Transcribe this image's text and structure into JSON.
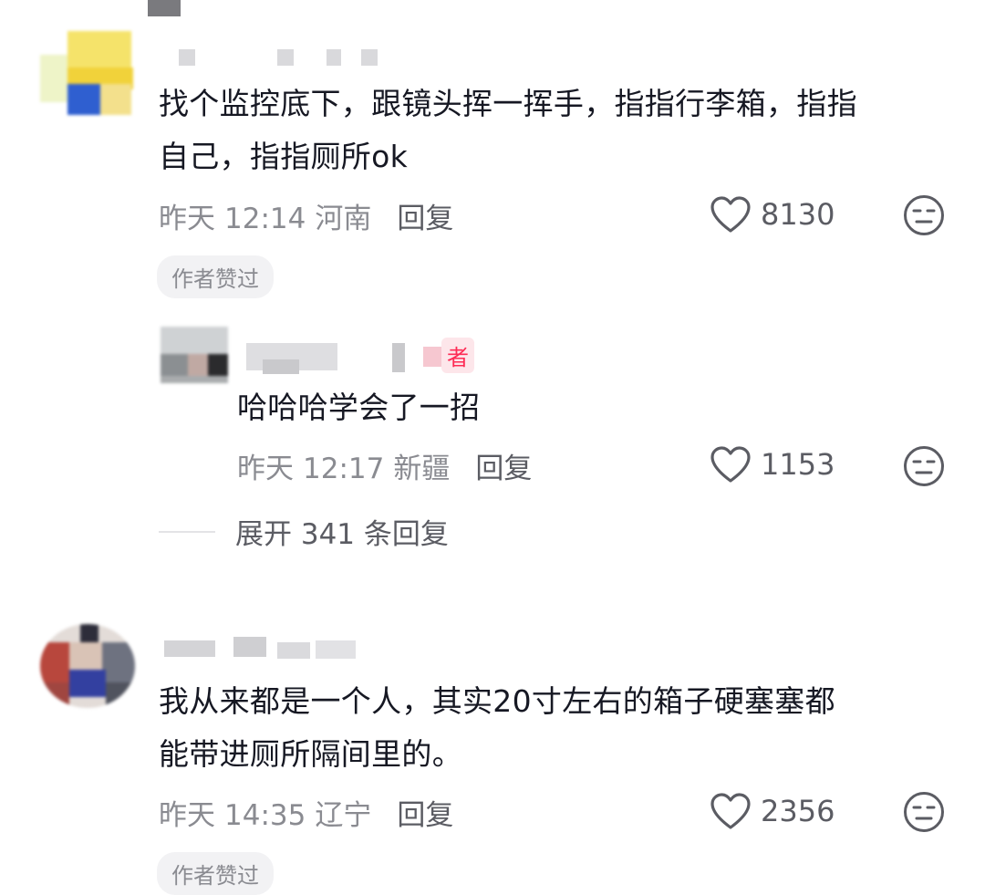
{
  "comments": [
    {
      "text_lines": [
        "找个监控底下，跟镜头挥一挥手，指指行李箱，指指",
        "自己，指指厕所ok"
      ],
      "date": "昨天",
      "time": "12:14",
      "location": "河南",
      "reply_label": "回复",
      "likes": "8130",
      "author_liked": "作者赞过",
      "reply": {
        "author_badge": "者",
        "text": "哈哈哈学会了一招",
        "date": "昨天",
        "time": "12:17",
        "location": "新疆",
        "reply_label": "回复",
        "likes": "1153"
      },
      "expand_label": "展开 341 条回复"
    },
    {
      "text_lines": [
        "我从来都是一个人，其实20寸左右的箱子硬塞塞都",
        "能带进厕所隔间里的。"
      ],
      "date": "昨天",
      "time": "14:35",
      "location": "辽宁",
      "reply_label": "回复",
      "likes": "2356",
      "author_liked": "作者赞过"
    }
  ],
  "colors": {
    "text": "#161823",
    "meta": "#8a8b91",
    "accent": "#fe2c55"
  },
  "icons": [
    "heart-outline-icon",
    "dislike-face-icon"
  ]
}
